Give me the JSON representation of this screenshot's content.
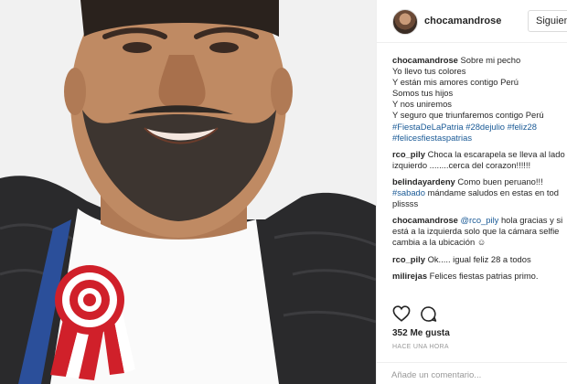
{
  "post": {
    "username": "chocamandrose",
    "follow_label": "Siguiendo",
    "caption": {
      "user": "chocamandrose",
      "lines": [
        "Sobre mi pecho",
        "Yo llevo tus colores",
        "Y están mis amores contigo Perú",
        "Somos tus hijos",
        "Y nos uniremos",
        "Y seguro que triunfaremos contigo Perú"
      ],
      "hashtags_line1": [
        "#FiestaDeLaPatria",
        "#28dejulio",
        "#feliz28"
      ],
      "hashtags_line2": [
        "#felicesfiestaspatrias"
      ]
    },
    "comments": [
      {
        "user": "rco_pily",
        "line1": "Choca la escarapela se lleva al lado",
        "line2": "izquierdo ........cerca del corazon!!!!!!"
      },
      {
        "user": "belindayardeny",
        "line1": "Como buen peruano!!!",
        "tag": "#sabado",
        "line2_rest": " mándame saludos en estas en tod",
        "line3": "plissss"
      },
      {
        "user": "chocamandrose",
        "mention": "@rco_pily",
        "line1_rest": " hola gracias y si",
        "line2": "está a la izquierda solo que la cámara selfie",
        "line3": "cambia a la ubicación ☺"
      },
      {
        "user": "rco_pily",
        "text": "Ok..... igual feliz 28 a todos"
      },
      {
        "user": "milirejas",
        "text": "Felices fiestas patrias primo."
      }
    ],
    "likes": "352 Me gusta",
    "time": "HACE UNA HORA",
    "add_comment_placeholder": "Añade un comentario..."
  },
  "icons": {
    "like": "heart-icon",
    "comment": "comment-bubble-icon",
    "photo": "selfie-photo"
  },
  "colors": {
    "link": "#1a5a96",
    "text": "#262626",
    "muted": "#999999",
    "cockade_red": "#d0202a"
  }
}
